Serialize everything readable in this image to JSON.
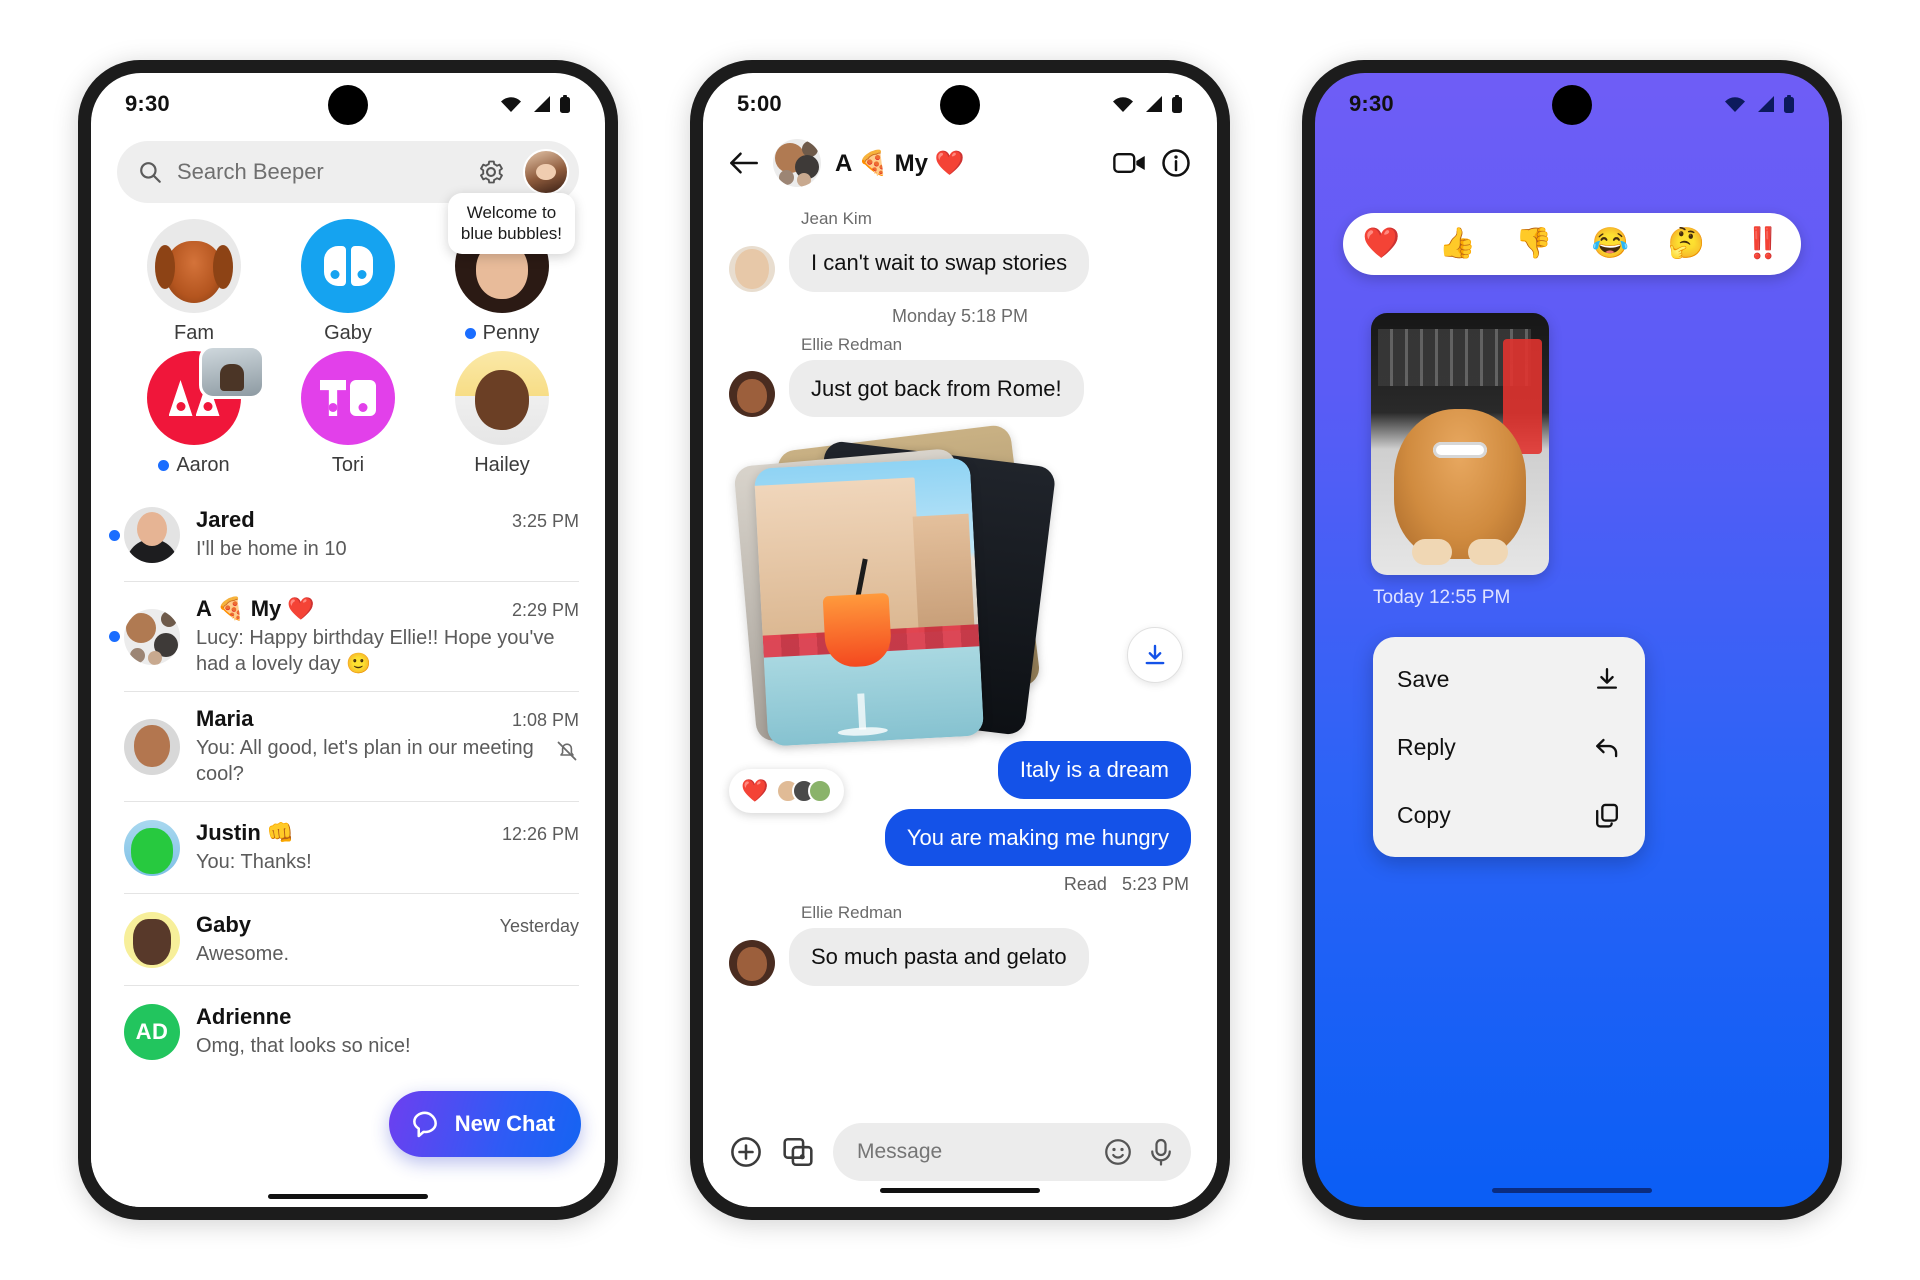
{
  "brand": {
    "accent_blue": "#1452e8",
    "fab_gradient_from": "#6d3ff0",
    "fab_gradient_to": "#1464f2",
    "phone3_gradient_from": "#6f5df6",
    "phone3_gradient_to": "#0a5ef5",
    "unread_dot": "#1a6dff"
  },
  "phone1": {
    "status": {
      "time": "9:30",
      "wifi": "wifi-icon",
      "signal": "cellular-icon",
      "battery": "battery-icon"
    },
    "search": {
      "placeholder": "Search Beeper",
      "search_icon": "search-icon",
      "settings_icon": "gear-icon",
      "avatar": "profile-avatar"
    },
    "tooltip": "Welcome to\nblue bubbles!",
    "favorites": [
      {
        "name": "Fam",
        "unread": false,
        "kind": "photo-dog"
      },
      {
        "name": "Gaby",
        "unread": false,
        "kind": "beeper-logo"
      },
      {
        "name": "Penny",
        "unread": true,
        "kind": "photo-person"
      },
      {
        "name": "Aaron",
        "unread": true,
        "kind": "logo-red"
      },
      {
        "name": "Tori",
        "unread": false,
        "kind": "logo-magenta"
      },
      {
        "name": "Hailey",
        "unread": false,
        "kind": "photo-person"
      }
    ],
    "chats": [
      {
        "name": "Jared",
        "emoji": "",
        "time": "3:25 PM",
        "preview": "I'll be home in 10",
        "unread": true,
        "muted": false,
        "avatar": "avJared"
      },
      {
        "name": "A 🍕 My ❤️",
        "emoji": "",
        "time": "2:29 PM",
        "preview": "Lucy: Happy birthday Ellie!! Hope you've had a lovely day  🙂",
        "unread": true,
        "muted": false,
        "avatar": "avGroup"
      },
      {
        "name": "Maria",
        "emoji": "",
        "time": "1:08 PM",
        "preview": "You: All good, let's plan in our meeting cool?",
        "unread": false,
        "muted": true,
        "avatar": "avMaria"
      },
      {
        "name": "Justin 👊",
        "emoji": "",
        "time": "12:26 PM",
        "preview": "You: Thanks!",
        "unread": false,
        "muted": false,
        "avatar": "avJustin"
      },
      {
        "name": "Gaby",
        "emoji": "",
        "time": "Yesterday",
        "preview": "Awesome.",
        "unread": false,
        "muted": false,
        "avatar": "avGabyc"
      },
      {
        "name": "Adrienne",
        "emoji": "",
        "time": "",
        "preview": "Omg, that looks so nice!",
        "unread": false,
        "muted": false,
        "avatar": "avAdrienne",
        "initials": "AD"
      }
    ],
    "fab": {
      "label": "New Chat",
      "icon": "chat-bubble-icon"
    }
  },
  "phone2": {
    "status": {
      "time": "5:00"
    },
    "header": {
      "back_icon": "back-arrow-icon",
      "title": "A 🍕 My ❤️",
      "video_icon": "video-camera-icon",
      "info_icon": "info-icon"
    },
    "messages": [
      {
        "type": "in",
        "sender": "Jean Kim",
        "text": "I can't wait to swap stories"
      },
      {
        "type": "timestamp",
        "text": "Monday 5:18 PM"
      },
      {
        "type": "in",
        "sender": "Ellie Redman",
        "text": "Just got back from Rome!"
      },
      {
        "type": "photos",
        "download_icon": "download-icon",
        "reaction": "❤️"
      },
      {
        "type": "out",
        "text": "Italy is a dream"
      },
      {
        "type": "out",
        "text": "You are making me hungry"
      },
      {
        "type": "receipt",
        "status": "Read",
        "time": "5:23 PM"
      },
      {
        "type": "in",
        "sender": "Ellie Redman",
        "text": "So much pasta and gelato"
      }
    ],
    "composer": {
      "plus_icon": "plus-circle-icon",
      "gallery_icon": "image-gallery-icon",
      "placeholder": "Message",
      "emoji_icon": "emoji-smiley-icon",
      "mic_icon": "microphone-icon"
    }
  },
  "phone3": {
    "status": {
      "time": "9:30"
    },
    "reactions": [
      "❤️",
      "👍",
      "👎",
      "😂",
      "🤔",
      "‼️"
    ],
    "photo": {
      "caption_day": "Today",
      "caption_time": "12:55 PM",
      "alt": "dog-with-sunglasses-photo"
    },
    "timestamp": "Today  12:55 PM",
    "menu": [
      {
        "label": "Save",
        "icon": "download-icon"
      },
      {
        "label": "Reply",
        "icon": "reply-arrow-icon"
      },
      {
        "label": "Copy",
        "icon": "copy-icon"
      }
    ]
  }
}
